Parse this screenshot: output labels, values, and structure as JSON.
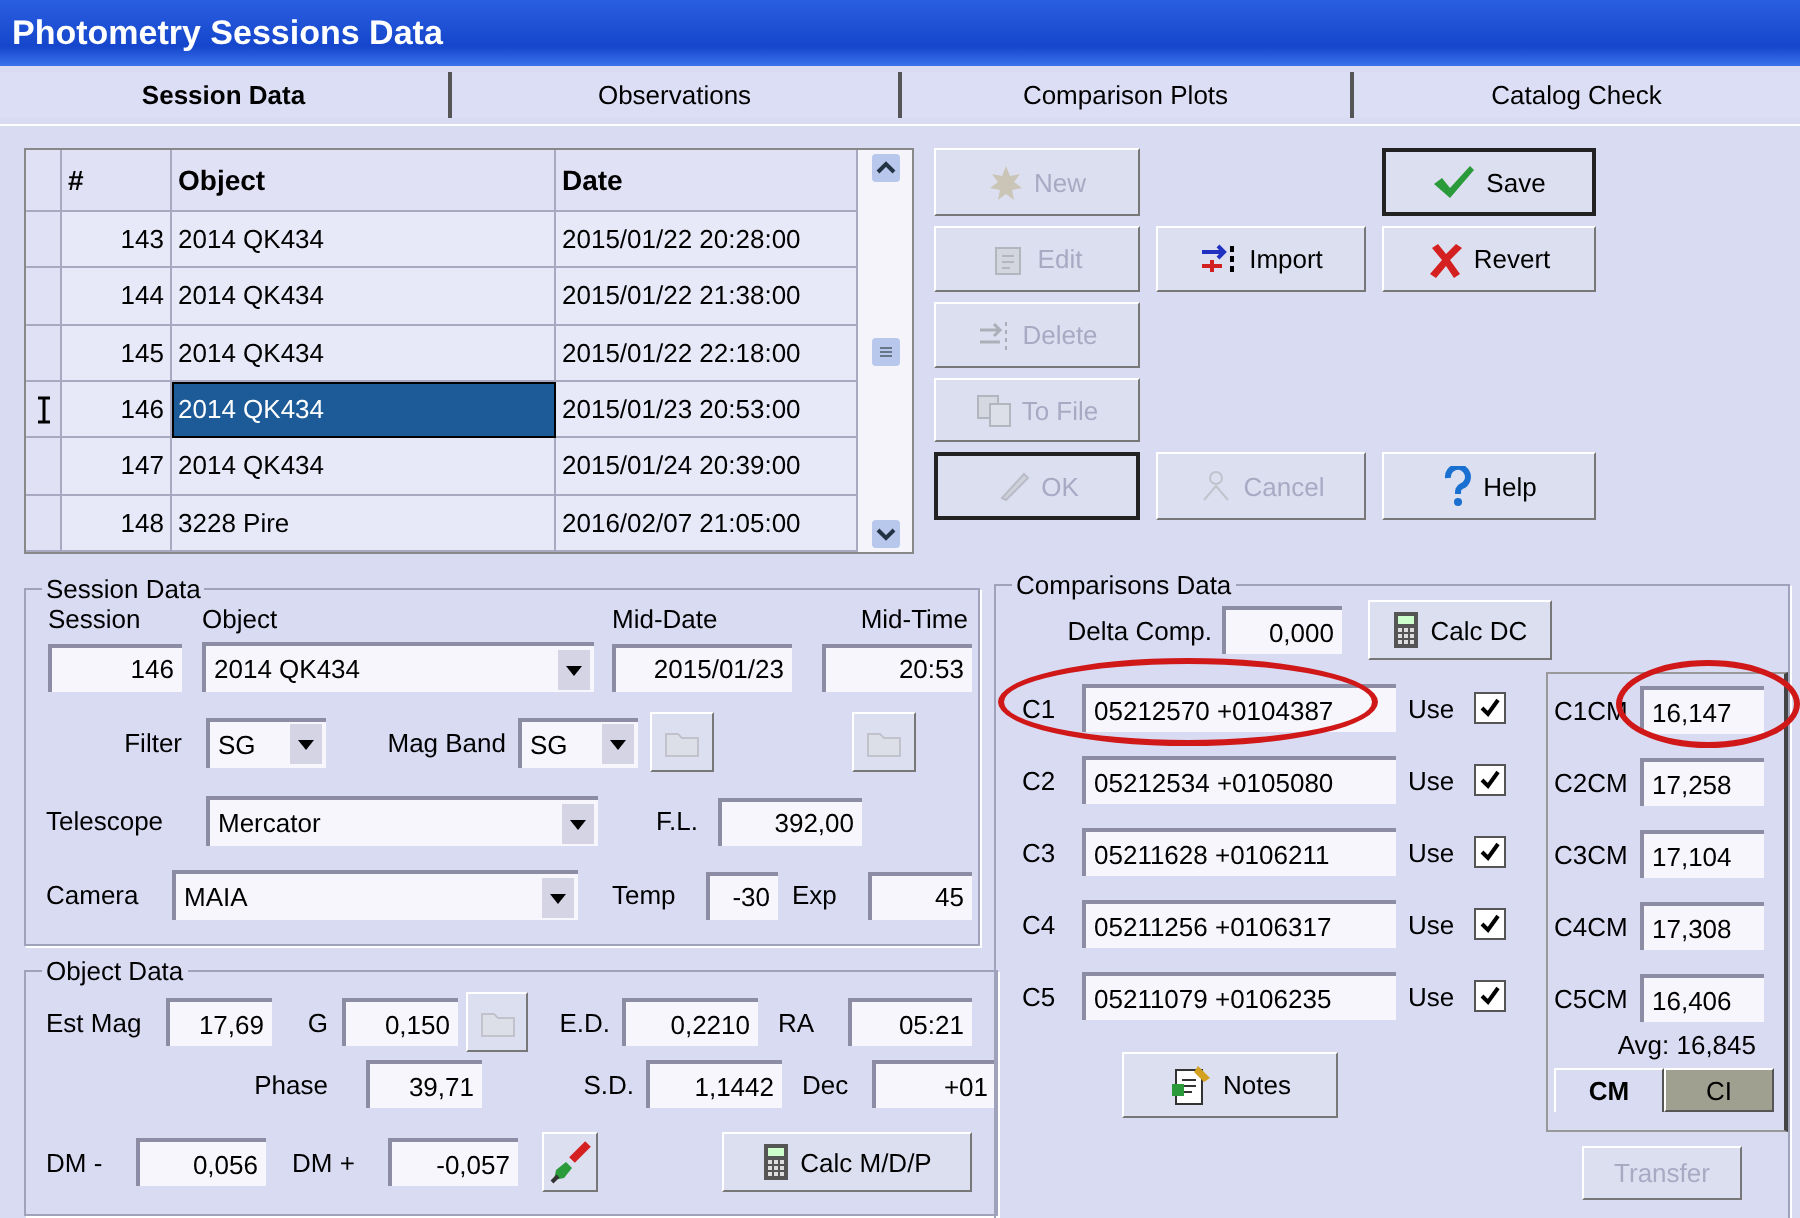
{
  "window": {
    "title": "Photometry Sessions Data"
  },
  "tabs": [
    {
      "label": "Session Data",
      "selected": true
    },
    {
      "label": "Observations",
      "selected": false
    },
    {
      "label": "Comparison Plots",
      "selected": false
    },
    {
      "label": "Catalog Check",
      "selected": false
    }
  ],
  "grid": {
    "columns": [
      "#",
      "Object",
      "Date"
    ],
    "rows": [
      {
        "number": "143",
        "object": "2014  QK434",
        "date": "2015/01/22  20:28:00",
        "selected": false
      },
      {
        "number": "144",
        "object": "2014  QK434",
        "date": "2015/01/22  21:38:00",
        "selected": false
      },
      {
        "number": "145",
        "object": "2014  QK434",
        "date": "2015/01/22  22:18:00",
        "selected": false
      },
      {
        "number": "146",
        "object": "2014  QK434",
        "date": "2015/01/23  20:53:00",
        "selected": true
      },
      {
        "number": "147",
        "object": "2014  QK434",
        "date": "2015/01/24  20:39:00",
        "selected": false
      },
      {
        "number": "148",
        "object": "3228 Pire",
        "date": "2016/02/07  21:05:00",
        "selected": false
      }
    ]
  },
  "buttons": {
    "new": {
      "label": "New",
      "disabled": true,
      "default": false
    },
    "edit": {
      "label": "Edit",
      "disabled": true,
      "default": false
    },
    "delete": {
      "label": "Delete",
      "disabled": true,
      "default": false
    },
    "to_file": {
      "label": "To File",
      "disabled": true,
      "default": false
    },
    "ok": {
      "label": "OK",
      "disabled": true,
      "default": true
    },
    "import": {
      "label": "Import",
      "disabled": false,
      "default": false
    },
    "cancel": {
      "label": "Cancel",
      "disabled": true,
      "default": false
    },
    "save": {
      "label": "Save",
      "disabled": false,
      "default": true
    },
    "revert": {
      "label": "Revert",
      "disabled": false,
      "default": false
    },
    "help": {
      "label": "Help",
      "disabled": false,
      "default": false
    }
  },
  "session_data": {
    "title": "Session Data",
    "session": {
      "label": "Session",
      "value": "146"
    },
    "object": {
      "label": "Object",
      "value": "2014  QK434"
    },
    "mid_date": {
      "label": "Mid-Date",
      "value": "2015/01/23"
    },
    "mid_time": {
      "label": "Mid-Time",
      "value": "20:53"
    },
    "filter": {
      "label": "Filter",
      "value": "SG"
    },
    "mag_band": {
      "label": "Mag Band",
      "value": "SG"
    },
    "band_button": {
      "disabled": true
    },
    "side_button": {
      "disabled": true
    },
    "telescope": {
      "label": "Telescope",
      "value": "Mercator"
    },
    "fl": {
      "label": "F.L.",
      "value": "392,00"
    },
    "camera": {
      "label": "Camera",
      "value": "MAIA"
    },
    "temp": {
      "label": "Temp",
      "value": "-30"
    },
    "exp": {
      "label": "Exp",
      "value": "45"
    }
  },
  "object_data": {
    "title": "Object Data",
    "est_mag": {
      "label": "Est Mag",
      "value": "17,69"
    },
    "g": {
      "label": "G",
      "value": "0,150"
    },
    "g_button": {
      "disabled": true
    },
    "ed": {
      "label": "E.D.",
      "value": "0,2210"
    },
    "ra": {
      "label": "RA",
      "value": "05:21"
    },
    "phase": {
      "label": "Phase",
      "value": "39,71"
    },
    "sd": {
      "label": "S.D.",
      "value": "1,1442"
    },
    "dec": {
      "label": "Dec",
      "value": "+01"
    },
    "dm_minus": {
      "label": "DM -",
      "value": "0,056"
    },
    "dm_plus": {
      "label": "DM +",
      "value": "-0,057"
    },
    "calc": {
      "label": "Calc M/D/P"
    }
  },
  "comparisons": {
    "title": "Comparisons Data",
    "delta_comp": {
      "label": "Delta Comp.",
      "value": "0,000"
    },
    "calc_dc": {
      "label": "Calc DC"
    },
    "comps": [
      {
        "label": "C1",
        "coords": "05212570 +0104387",
        "use_label": "Use",
        "use": true,
        "cm_label": "C1CM",
        "cm": "16,147",
        "circled": true
      },
      {
        "label": "C2",
        "coords": "05212534 +0105080",
        "use_label": "Use",
        "use": true,
        "cm_label": "C2CM",
        "cm": "17,258",
        "circled": false
      },
      {
        "label": "C3",
        "coords": "05211628 +0106211",
        "use_label": "Use",
        "use": true,
        "cm_label": "C3CM",
        "cm": "17,104",
        "circled": false
      },
      {
        "label": "C4",
        "coords": "05211256 +0106317",
        "use_label": "Use",
        "use": true,
        "cm_label": "C4CM",
        "cm": "17,308",
        "circled": false
      },
      {
        "label": "C5",
        "coords": "05211079 +0106235",
        "use_label": "Use",
        "use": true,
        "cm_label": "C5CM",
        "cm": "16,406",
        "circled": false
      }
    ],
    "avg": "Avg: 16,845",
    "panel_tabs": [
      {
        "label": "CM",
        "selected": true
      },
      {
        "label": "CI",
        "selected": false
      }
    ],
    "notes": {
      "label": "Notes"
    },
    "transfer": {
      "label": "Transfer",
      "disabled": true
    }
  }
}
